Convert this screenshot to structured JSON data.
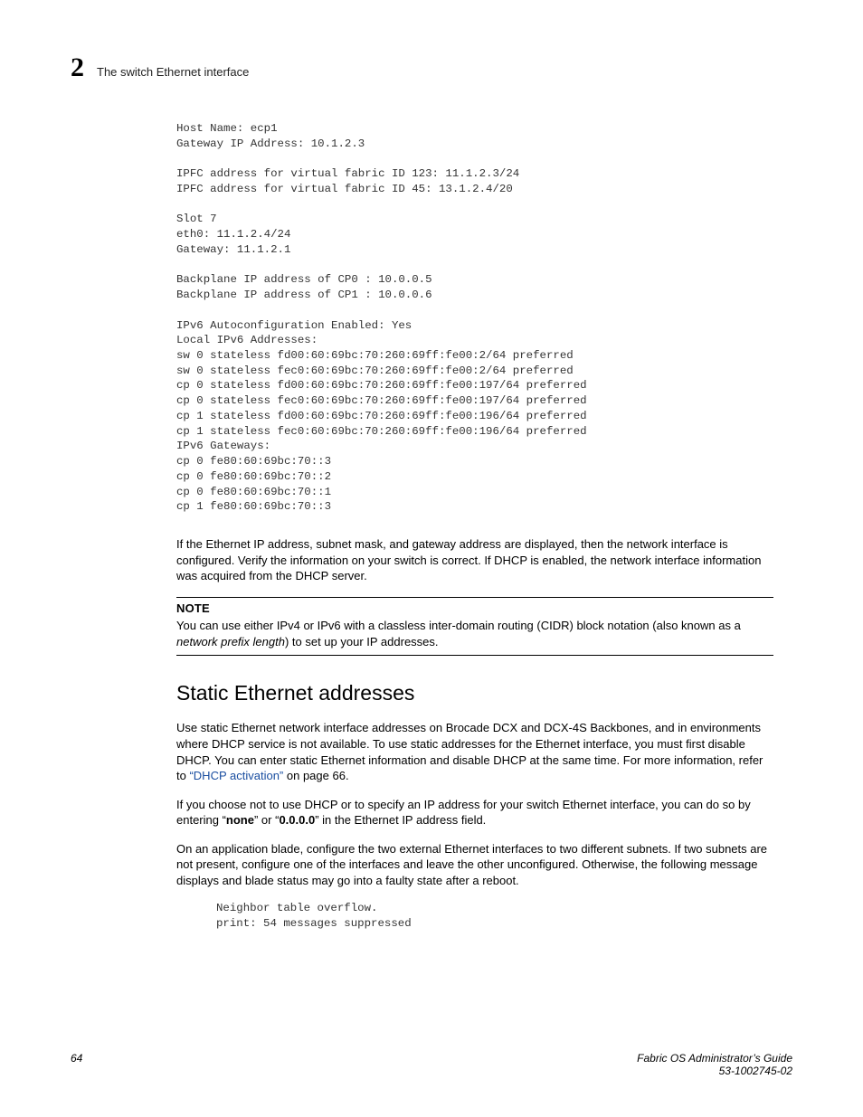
{
  "header": {
    "chapter_number": "2",
    "chapter_title": "The switch Ethernet interface"
  },
  "code_output": "Host Name: ecp1\nGateway IP Address: 10.1.2.3\n\nIPFC address for virtual fabric ID 123: 11.1.2.3/24\nIPFC address for virtual fabric ID 45: 13.1.2.4/20\n\nSlot 7\neth0: 11.1.2.4/24\nGateway: 11.1.2.1\n\nBackplane IP address of CP0 : 10.0.0.5\nBackplane IP address of CP1 : 10.0.0.6\n\nIPv6 Autoconfiguration Enabled: Yes\nLocal IPv6 Addresses:\nsw 0 stateless fd00:60:69bc:70:260:69ff:fe00:2/64 preferred\nsw 0 stateless fec0:60:69bc:70:260:69ff:fe00:2/64 preferred\ncp 0 stateless fd00:60:69bc:70:260:69ff:fe00:197/64 preferred\ncp 0 stateless fec0:60:69bc:70:260:69ff:fe00:197/64 preferred\ncp 1 stateless fd00:60:69bc:70:260:69ff:fe00:196/64 preferred\ncp 1 stateless fec0:60:69bc:70:260:69ff:fe00:196/64 preferred\nIPv6 Gateways:\ncp 0 fe80:60:69bc:70::3\ncp 0 fe80:60:69bc:70::2\ncp 0 fe80:60:69bc:70::1\ncp 1 fe80:60:69bc:70::3",
  "para1": "If the Ethernet IP address, subnet mask, and gateway address are displayed, then the network interface is configured. Verify the information on your switch is correct. If DHCP is enabled, the network interface information was acquired from the DHCP server.",
  "note": {
    "label": "NOTE",
    "text_before_ital": "You can use either IPv4 or IPv6 with a classless inter-domain routing (CIDR) block notation (also known as a ",
    "ital": "network prefix length",
    "text_after_ital": ") to set up your IP addresses."
  },
  "subhead": "Static Ethernet addresses",
  "para2": {
    "before_link": "Use static Ethernet network interface addresses on Brocade DCX and DCX-4S Backbones, and in environments where DHCP service is not available. To use static addresses for the Ethernet interface, you must first disable DHCP. You can enter static Ethernet information and disable DHCP at the same time. For more information, refer to ",
    "link": "“DHCP activation”",
    "after_link": " on page 66."
  },
  "para3": {
    "p1": "If you choose not to use DHCP or to specify an IP address for your switch Ethernet interface, you can do so by entering “",
    "b1": "none",
    "p2": "” or “",
    "b2": "0.0.0.0",
    "p3": "” in the Ethernet IP address field."
  },
  "para4": "On an application blade, configure the two external Ethernet interfaces to two different subnets. If two subnets are not present, configure one of the interfaces and leave the other unconfigured. Otherwise, the following message displays and blade status may go into a faulty state after a reboot.",
  "code_msg": "Neighbor table overflow.\nprint: 54 messages suppressed",
  "footer": {
    "page_number": "64",
    "doc_title": "Fabric OS Administrator’s Guide",
    "doc_id": "53-1002745-02"
  }
}
